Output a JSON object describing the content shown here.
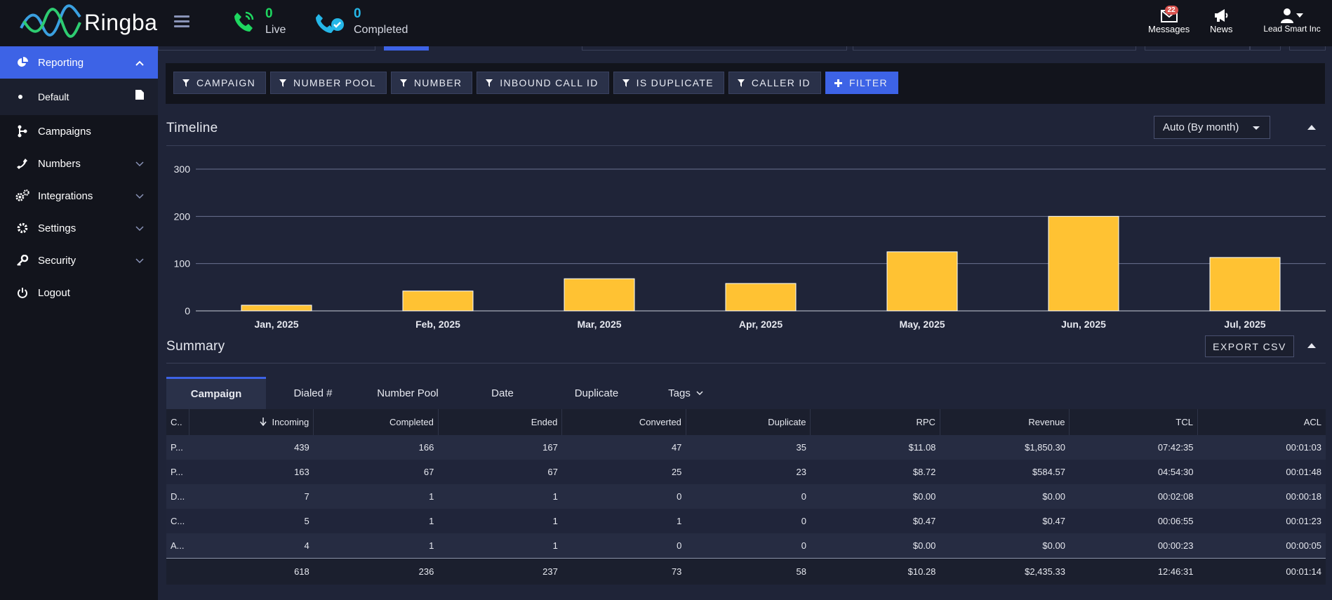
{
  "app": {
    "brand": "Ringba",
    "live_count": "0",
    "live_label": "Live",
    "completed_count": "0",
    "completed_label": "Completed",
    "messages_label": "Messages",
    "messages_badge": "22",
    "news_label": "News",
    "account_label": "Lead Smart Inc"
  },
  "sidebar": {
    "items": [
      {
        "label": "Reporting",
        "icon": "pie-chart-icon"
      },
      {
        "label": "Default",
        "icon": "document-icon"
      },
      {
        "label": "Campaigns",
        "icon": "campaigns-icon"
      },
      {
        "label": "Numbers",
        "icon": "phone-icon"
      },
      {
        "label": "Integrations",
        "icon": "gears-icon"
      },
      {
        "label": "Settings",
        "icon": "gear-icon"
      },
      {
        "label": "Security",
        "icon": "key-icon"
      },
      {
        "label": "Logout",
        "icon": "power-icon"
      }
    ]
  },
  "filters": {
    "buttons": [
      "CAMPAIGN",
      "NUMBER POOL",
      "NUMBER",
      "INBOUND CALL ID",
      "IS DUPLICATE",
      "CALLER ID"
    ],
    "add_filter": "FILTER"
  },
  "timeline": {
    "title": "Timeline",
    "granularity": "Auto (By month)"
  },
  "chart_data": {
    "type": "bar",
    "categories": [
      "Jan, 2025",
      "Feb, 2025",
      "Mar, 2025",
      "Apr, 2025",
      "May, 2025",
      "Jun, 2025",
      "Jul, 2025"
    ],
    "values": [
      12,
      42,
      68,
      58,
      125,
      200,
      113
    ],
    "yticks": [
      0,
      100,
      200,
      300
    ],
    "ylim": [
      0,
      300
    ],
    "bar_color": "#ffc233",
    "grid": true
  },
  "summary": {
    "title": "Summary",
    "export_label": "EXPORT CSV",
    "tabs": [
      "Campaign",
      "Dialed #",
      "Number Pool",
      "Date",
      "Duplicate",
      "Tags"
    ],
    "columns": [
      "C..",
      "Incoming",
      "Completed",
      "Ended",
      "Converted",
      "Duplicate",
      "RPC",
      "Revenue",
      "TCL",
      "ACL"
    ],
    "rows": [
      [
        "P...",
        "439",
        "166",
        "167",
        "47",
        "35",
        "$11.08",
        "$1,850.30",
        "07:42:35",
        "00:01:03"
      ],
      [
        "P...",
        "163",
        "67",
        "67",
        "25",
        "23",
        "$8.72",
        "$584.57",
        "04:54:30",
        "00:01:48"
      ],
      [
        "D...",
        "7",
        "1",
        "1",
        "0",
        "0",
        "$0.00",
        "$0.00",
        "00:02:08",
        "00:00:18"
      ],
      [
        "C...",
        "5",
        "1",
        "1",
        "1",
        "0",
        "$0.47",
        "$0.47",
        "00:06:55",
        "00:01:23"
      ],
      [
        "A...",
        "4",
        "1",
        "1",
        "0",
        "0",
        "$0.00",
        "$0.00",
        "00:00:23",
        "00:00:05"
      ]
    ],
    "totals": [
      "",
      "618",
      "236",
      "237",
      "73",
      "58",
      "$10.28",
      "$2,435.33",
      "12:46:31",
      "00:01:14"
    ]
  }
}
